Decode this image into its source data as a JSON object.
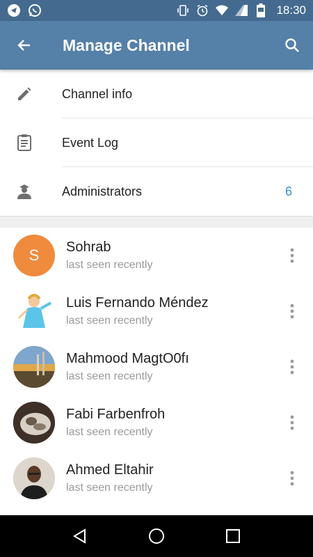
{
  "status_bar": {
    "time": "18:30",
    "left_icons": [
      "telegram-icon",
      "whatsapp-icon"
    ],
    "right_icons": [
      "vibrate-icon",
      "alarm-icon",
      "wifi-icon",
      "sim-icon",
      "battery-icon"
    ],
    "background": "#446b8f"
  },
  "app_bar": {
    "title": "Manage Channel",
    "background": "#5580a8"
  },
  "menu": [
    {
      "label": "Channel info",
      "icon": "pencil-icon"
    },
    {
      "label": "Event Log",
      "icon": "clipboard-icon"
    },
    {
      "label": "Administrators",
      "icon": "admin-icon",
      "count": "6"
    }
  ],
  "members": [
    {
      "name": "Sohrab",
      "status": "last seen recently",
      "initial": "S",
      "avatar_color": "#f08a3c"
    },
    {
      "name": "Luis Fernando Méndez",
      "status": "last seen recently",
      "initial": "",
      "avatar_color": "#ffffff"
    },
    {
      "name": "Mahmood MagtO0fı",
      "status": "last seen recently",
      "initial": "",
      "avatar_color": "#8a7a5a"
    },
    {
      "name": "Fabi Farbenfroh",
      "status": "last seen recently",
      "initial": "",
      "avatar_color": "#5a4a3a"
    },
    {
      "name": "Ahmed Eltahir",
      "status": "last seen recently",
      "initial": "",
      "avatar_color": "#d8d2c6"
    }
  ],
  "colors": {
    "accent_count": "#3a8fd0",
    "secondary_text": "#9a9a9a"
  }
}
